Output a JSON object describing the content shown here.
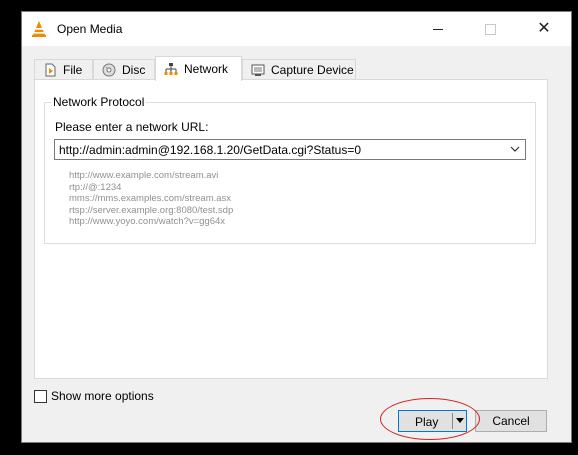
{
  "window": {
    "title": "Open Media",
    "controls": {
      "minimize": "minimize-icon",
      "maximize": "maximize-icon",
      "close": "close-icon"
    },
    "close_glyph": "✕"
  },
  "tabs": [
    {
      "label": "File",
      "icon": "file-icon"
    },
    {
      "label": "Disc",
      "icon": "disc-icon"
    },
    {
      "label": "Network",
      "icon": "network-icon",
      "active": true
    },
    {
      "label": "Capture Device",
      "icon": "capture-device-icon"
    }
  ],
  "network": {
    "group_title": "Network Protocol",
    "url_label": "Please enter a network URL:",
    "url_value": "http://admin:admin@192.168.1.20/GetData.cgi?Status=0",
    "examples": [
      "http://www.example.com/stream.avi",
      "rtp://@:1234",
      "mms://mms.examples.com/stream.asx",
      "rtsp://server.example.org:8080/test.sdp",
      "http://www.yoyo.com/watch?v=gg64x"
    ]
  },
  "options": {
    "show_more_label": "Show more options",
    "show_more_checked": false
  },
  "buttons": {
    "play": "Play",
    "cancel": "Cancel"
  },
  "colors": {
    "annotation": "#d42020",
    "accent": "#0078d7",
    "vlc_orange": "#f08a00"
  }
}
